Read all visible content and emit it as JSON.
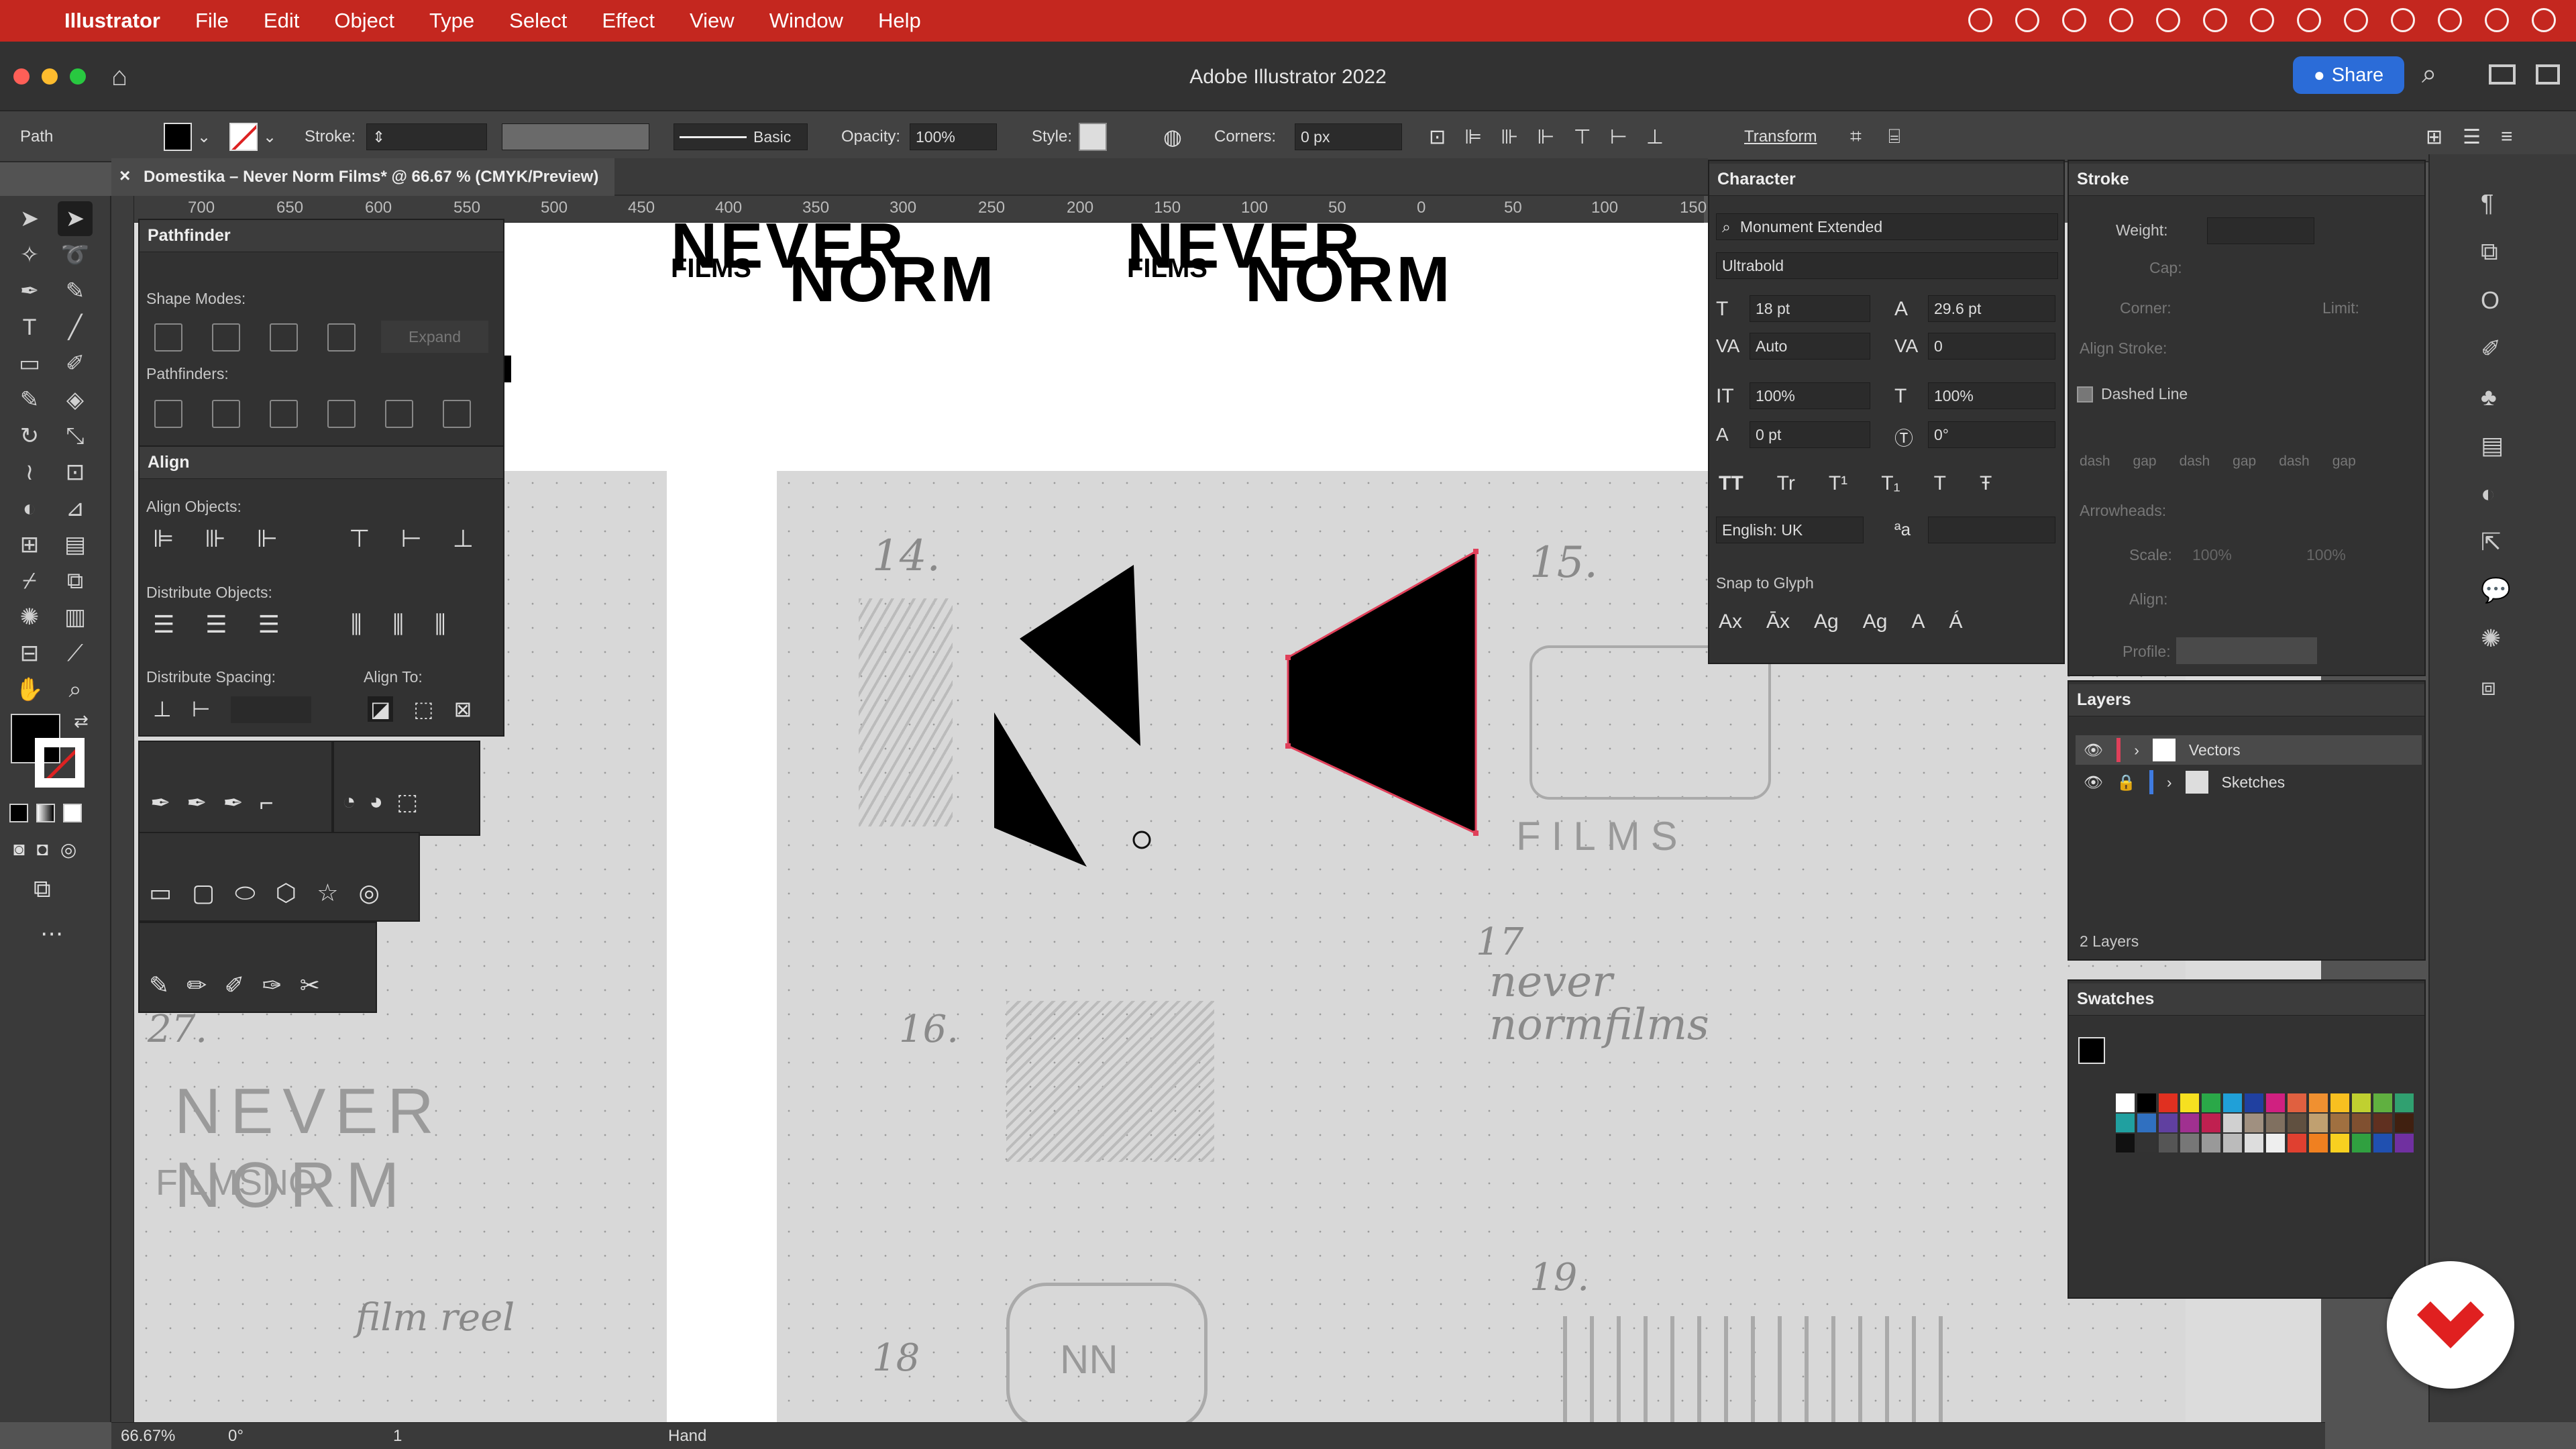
{
  "menubar": {
    "app": "Illustrator",
    "items": [
      "File",
      "Edit",
      "Object",
      "Type",
      "Select",
      "Effect",
      "View",
      "Window",
      "Help"
    ]
  },
  "titlebar": {
    "title": "Adobe Illustrator 2022",
    "share": "Share"
  },
  "controlbar": {
    "selection": "Path",
    "stroke_label": "Stroke:",
    "brush": "Basic",
    "opacity_label": "Opacity:",
    "opacity": "100%",
    "style_label": "Style:",
    "corners_label": "Corners:",
    "corners": "0 px",
    "transform": "Transform"
  },
  "document": {
    "tab": "Domestika – Never Norm Films* @ 66.67 % (CMYK/Preview)"
  },
  "ruler": {
    "h": [
      "700",
      "650",
      "600",
      "550",
      "500",
      "450",
      "400",
      "350",
      "300",
      "250",
      "200",
      "150",
      "100",
      "50",
      "0",
      "50",
      "100",
      "150"
    ]
  },
  "pathfinder": {
    "title": "Pathfinder",
    "shape_modes": "Shape Modes:",
    "expand": "Expand",
    "pathfinders": "Pathfinders:"
  },
  "align": {
    "title": "Align",
    "align_objects": "Align Objects:",
    "distribute_objects": "Distribute Objects:",
    "distribute_spacing": "Distribute Spacing:",
    "align_to": "Align To:"
  },
  "character": {
    "title": "Character",
    "font": "Monument Extended",
    "weight": "Ultrabold",
    "size": "18 pt",
    "leading": "29.6 pt",
    "kerning": "Auto",
    "tracking": "0",
    "vscale": "100%",
    "hscale": "100%",
    "baseline": "0 pt",
    "rotation": "0°",
    "language": "English: UK",
    "snap": "Snap to Glyph"
  },
  "stroke": {
    "title": "Stroke",
    "weight": "Weight:",
    "cap": "Cap:",
    "corner": "Corner:",
    "limit": "Limit:",
    "align_stroke": "Align Stroke:",
    "dashed": "Dashed Line",
    "dash_labels": [
      "dash",
      "gap",
      "dash",
      "gap",
      "dash",
      "gap"
    ],
    "arrowheads": "Arrowheads:",
    "scale": "Scale:",
    "align": "Align:",
    "profile": "Profile:",
    "scale_val": "100%"
  },
  "layers": {
    "title": "Layers",
    "items": [
      "Vectors",
      "Sketches"
    ],
    "count": "2 Layers"
  },
  "swatches": {
    "title": "Swatches"
  },
  "artwork": {
    "logo_small": "FILMS",
    "logo_never": "NEVER",
    "logo_norm": "NORM"
  },
  "sketch_notes": {
    "n14": "14.",
    "n15": "15.",
    "n16": "16.",
    "n17": "17",
    "n18": "18",
    "n19": "19.",
    "n27": "27.",
    "films": "FILMS",
    "never_norm": "never normfilms",
    "nevernorm_big": "NEVER NORM",
    "filmsno": "FILMSNO",
    "filmreel": "film reel",
    "nn": "NN"
  },
  "statusbar": {
    "zoom": "66.67%",
    "angle": "0°",
    "page": "1",
    "tool": "Hand"
  },
  "colors": {
    "accent": "#c4271f",
    "share": "#2b6cd8",
    "selection": "#e0405a"
  }
}
